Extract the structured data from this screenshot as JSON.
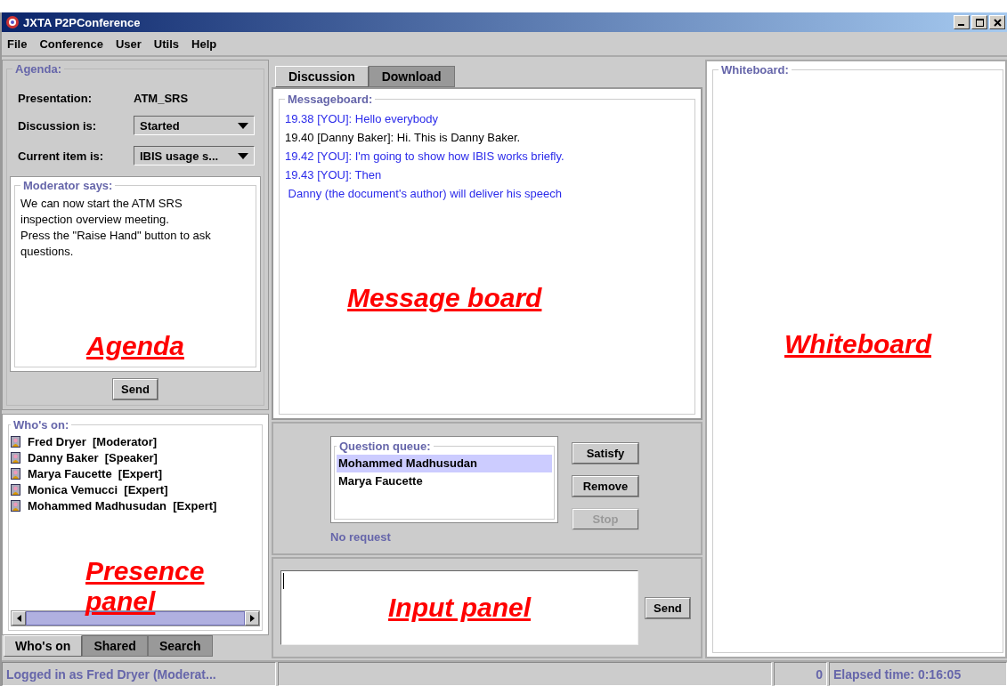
{
  "window": {
    "title": "JXTA P2PConference"
  },
  "menu": [
    "File",
    "Conference",
    "User",
    "Utils",
    "Help"
  ],
  "agenda": {
    "title": "Agenda:",
    "presentation_label": "Presentation:",
    "presentation": "ATM_SRS",
    "discussion_label": "Discussion is:",
    "discussion": "Started",
    "item_label": "Current item is:",
    "item": "IBIS usage s...",
    "moderator_title": "Moderator says:",
    "moderator_text": [
      "We can now start the ATM SRS",
      "inspection overview meeting.",
      "Press the \"Raise Hand\" button to ask",
      "questions."
    ],
    "annotation": "Agenda",
    "send": "Send"
  },
  "presence": {
    "title": "Who's on:",
    "annotation": "Presence panel",
    "people": [
      {
        "name": "Fred Dryer",
        "role": "[Moderator]"
      },
      {
        "name": "Danny Baker",
        "role": "[Speaker]"
      },
      {
        "name": "Marya Faucette",
        "role": "[Expert]"
      },
      {
        "name": "Monica Vemucci",
        "role": "[Expert]"
      },
      {
        "name": "Mohammed Madhusudan",
        "role": "[Expert]"
      }
    ]
  },
  "left_tabs": [
    {
      "label": "Who's on",
      "selected": true
    },
    {
      "label": "Shared",
      "selected": false
    },
    {
      "label": "Search",
      "selected": false
    }
  ],
  "center_tabs": [
    {
      "label": "Discussion",
      "selected": true
    },
    {
      "label": "Download",
      "selected": false
    }
  ],
  "messageboard": {
    "title": "Messageboard:",
    "annotation": "Message board",
    "messages": [
      {
        "text": "19.38 [YOU]: Hello everybody",
        "color": "#2b2bea"
      },
      {
        "text": "19.40 [Danny Baker]: Hi. This is Danny Baker.",
        "color": "#000000"
      },
      {
        "text": "19.42 [YOU]: I'm going to show how IBIS works briefly.",
        "color": "#2b2bea"
      },
      {
        "text": "19.43 [YOU]: Then",
        "color": "#2b2bea"
      },
      {
        "text": " Danny (the document's author) will deliver his speech",
        "color": "#2b2bea"
      }
    ]
  },
  "question_queue": {
    "title": "Question queue:",
    "items": [
      {
        "name": "Mohammed Madhusudan",
        "selected": true
      },
      {
        "name": "Marya Faucette",
        "selected": false
      }
    ],
    "status": "No request",
    "buttons": [
      {
        "label": "Satisfy",
        "disabled": false
      },
      {
        "label": "Remove",
        "disabled": false
      },
      {
        "label": "Stop",
        "disabled": true
      }
    ]
  },
  "input_panel": {
    "annotation": "Input panel",
    "send": "Send"
  },
  "whiteboard": {
    "title": "Whiteboard:",
    "annotation": "Whiteboard"
  },
  "status_bar": {
    "login": "Logged in as Fred Dryer (Moderat...",
    "count": "0",
    "elapsed": "Elapsed time: 0:16:05"
  }
}
